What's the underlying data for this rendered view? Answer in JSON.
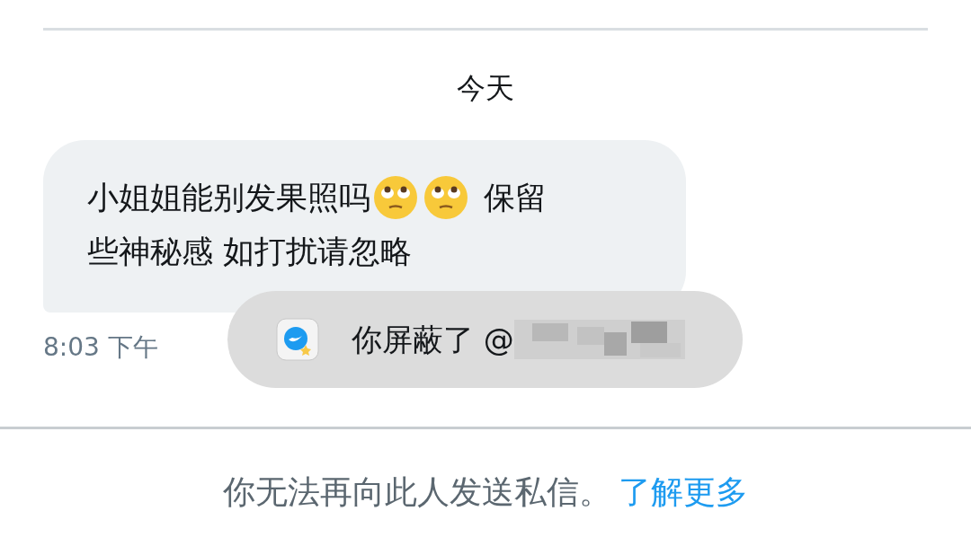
{
  "date_separator": "今天",
  "message": {
    "text_before": "小姐姐能别发果照吗",
    "emojis": [
      {
        "kind": "rolling-eyes"
      },
      {
        "kind": "rolling-eyes"
      }
    ],
    "text_after": "保留",
    "line_2": "些神秘感 如打扰请忽略",
    "time": "8:03 下午"
  },
  "toast": {
    "text": "你屏蔽了 @"
  },
  "footer": {
    "notice": "你无法再向此人发送私信。",
    "link": "了解更多"
  }
}
